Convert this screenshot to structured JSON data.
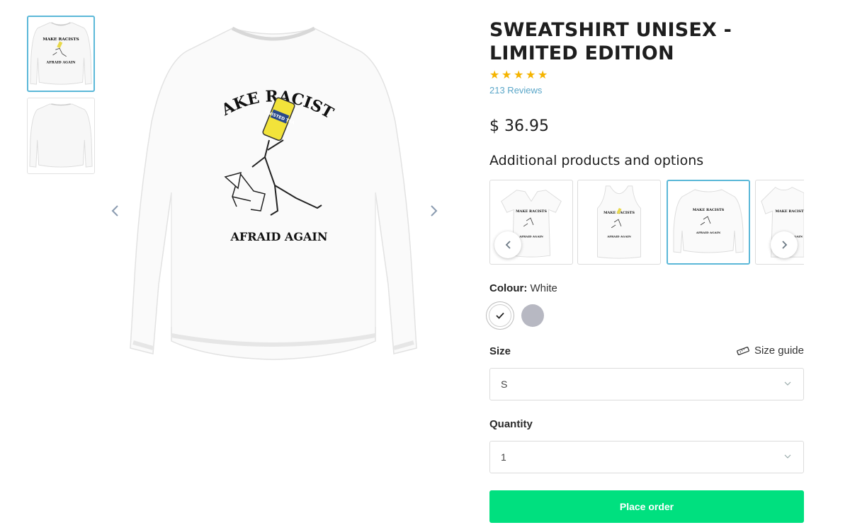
{
  "product": {
    "title": "SWEATSHIRT UNISEX - LIMITED EDITION",
    "rating": 5,
    "reviews_text": "213 Reviews",
    "price": "$ 36.95"
  },
  "print": {
    "line1": "MAKE RACISTS",
    "line2": "AFRAID AGAIN",
    "can_text": "TWISTED TEA"
  },
  "options": {
    "heading": "Additional products and options",
    "cards": [
      "womens-vneck",
      "tank-top",
      "sweatshirt",
      "womens-tee"
    ],
    "selected_index": 2
  },
  "colour": {
    "label": "Colour:",
    "value": "White",
    "swatches": [
      {
        "name": "White",
        "hex": "#ffffff",
        "selected": true
      },
      {
        "name": "Grey",
        "hex": "#b7b8c2",
        "selected": false
      }
    ]
  },
  "size": {
    "label": "Size",
    "guide_label": "Size guide",
    "value": "S"
  },
  "quantity": {
    "label": "Quantity",
    "value": "1"
  },
  "cta": {
    "label": "Place order",
    "color": "#00e07f"
  },
  "accent": "#5bb8d8"
}
